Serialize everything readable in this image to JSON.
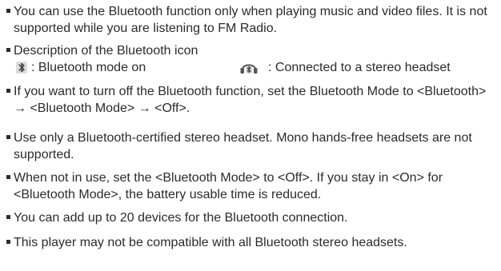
{
  "bullets": [
    "You can use the Bluetooth function only when playing music and video files. It is not supported while you are listening to FM Radio.",
    "Description of the Bluetooth icon",
    "If you want to turn off the Bluetooth function, set the Bluetooth Mode to <Bluetooth> → <Bluetooth Mode> → <Off>.",
    "Use only a Bluetooth-certified stereo headset. Mono hands-free headsets are not supported.",
    "When not in use, set the <Bluetooth Mode> to <Off>. If you stay in <On> for <Bluetooth Mode>, the battery usable time is reduced.",
    "You can add up to 20 devices for the Bluetooth connection.",
    "This player may not be compatible with all Bluetooth stereo headsets."
  ],
  "icon_legend": [
    {
      "icon": "bluetooth-icon",
      "text": ": Bluetooth mode on"
    },
    {
      "icon": "stereo-headset-icon",
      "text": ": Connected to a stereo headset"
    }
  ]
}
